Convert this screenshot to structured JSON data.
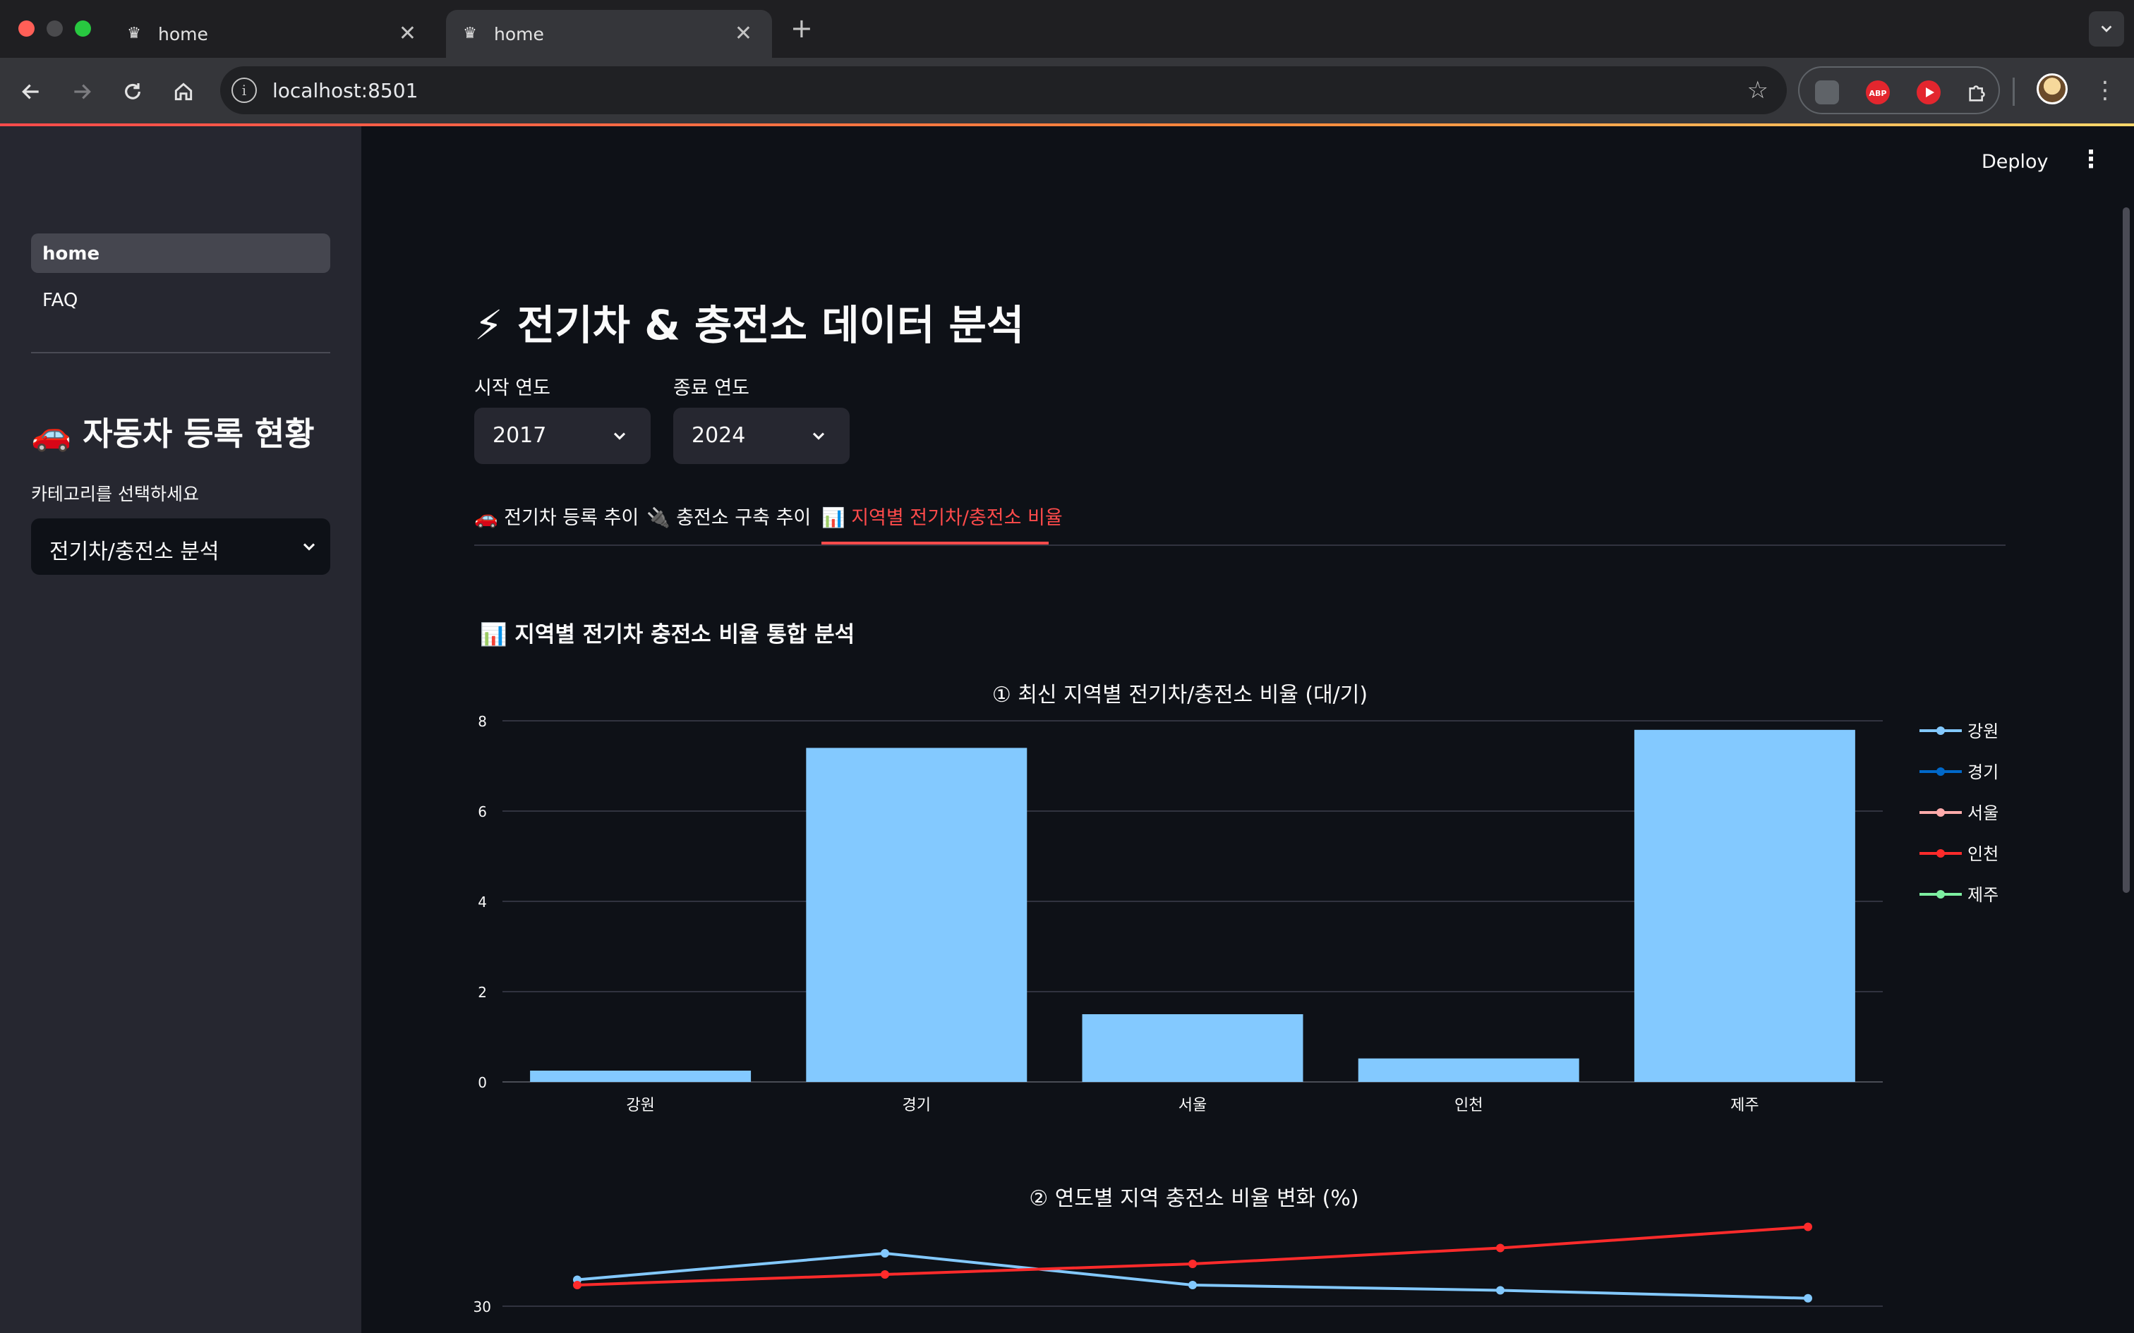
{
  "browser": {
    "tabs": [
      {
        "title": "home",
        "active": false
      },
      {
        "title": "home",
        "active": true
      }
    ],
    "url": "localhost:8501",
    "extensions": [
      "media-ext-icon",
      "adblock-plus-icon",
      "youtube-ext-icon",
      "extensions-puzzle-icon"
    ]
  },
  "header": {
    "deploy_label": "Deploy"
  },
  "sidebar": {
    "nav": [
      {
        "label": "home",
        "active": true
      },
      {
        "label": "FAQ",
        "active": false
      }
    ],
    "header": "🚗 자동차 등록 현황",
    "category_label": "카테고리를 선택하세요",
    "category_value": "전기차/충전소 분석"
  },
  "main": {
    "title": "⚡ 전기차 & 충전소 데이터 분석",
    "start_year_label": "시작 연도",
    "start_year": "2017",
    "end_year_label": "종료 연도",
    "end_year": "2024",
    "tabs": [
      {
        "label": "🚗 전기차 등록 추이",
        "active": false
      },
      {
        "label": "🔌 충전소 구축 추이",
        "active": false
      },
      {
        "label": "📊 지역별 전기차/충전소 비율",
        "active": true
      }
    ],
    "subheader": "📊 지역별 전기차 충전소 비율 통합 분석"
  },
  "colors": {
    "accent": "#ff4b4b",
    "bar": "#83c9ff",
    "series": [
      "#83c9ff",
      "#0068c9",
      "#ffabab",
      "#ff2b2b",
      "#7defa1"
    ]
  },
  "chart_data": [
    {
      "type": "bar",
      "title": "① 최신 지역별 전기차/충전소 비율 (대/기)",
      "categories": [
        "강원",
        "경기",
        "서울",
        "인천",
        "제주"
      ],
      "values": [
        0.25,
        7.4,
        1.5,
        0.52,
        7.8
      ],
      "ylim": [
        0,
        8
      ],
      "yticks": [
        0,
        2,
        4,
        6,
        8
      ],
      "legend": [
        "강원",
        "경기",
        "서울",
        "인천",
        "제주"
      ],
      "legend_position": "right",
      "grid": true
    },
    {
      "type": "line",
      "title": "② 연도별 지역 충전소 비율 변화 (%)",
      "x": [
        0,
        1,
        2,
        3,
        4
      ],
      "yticks": [
        30
      ],
      "series": [
        {
          "name": "강원",
          "values": [
            30.5,
            31.0,
            30.4,
            30.3,
            30.15
          ]
        },
        {
          "name": "인천",
          "values": [
            30.4,
            30.6,
            30.8,
            31.1,
            31.5
          ]
        }
      ],
      "visible_range": [
        30,
        32
      ]
    }
  ]
}
